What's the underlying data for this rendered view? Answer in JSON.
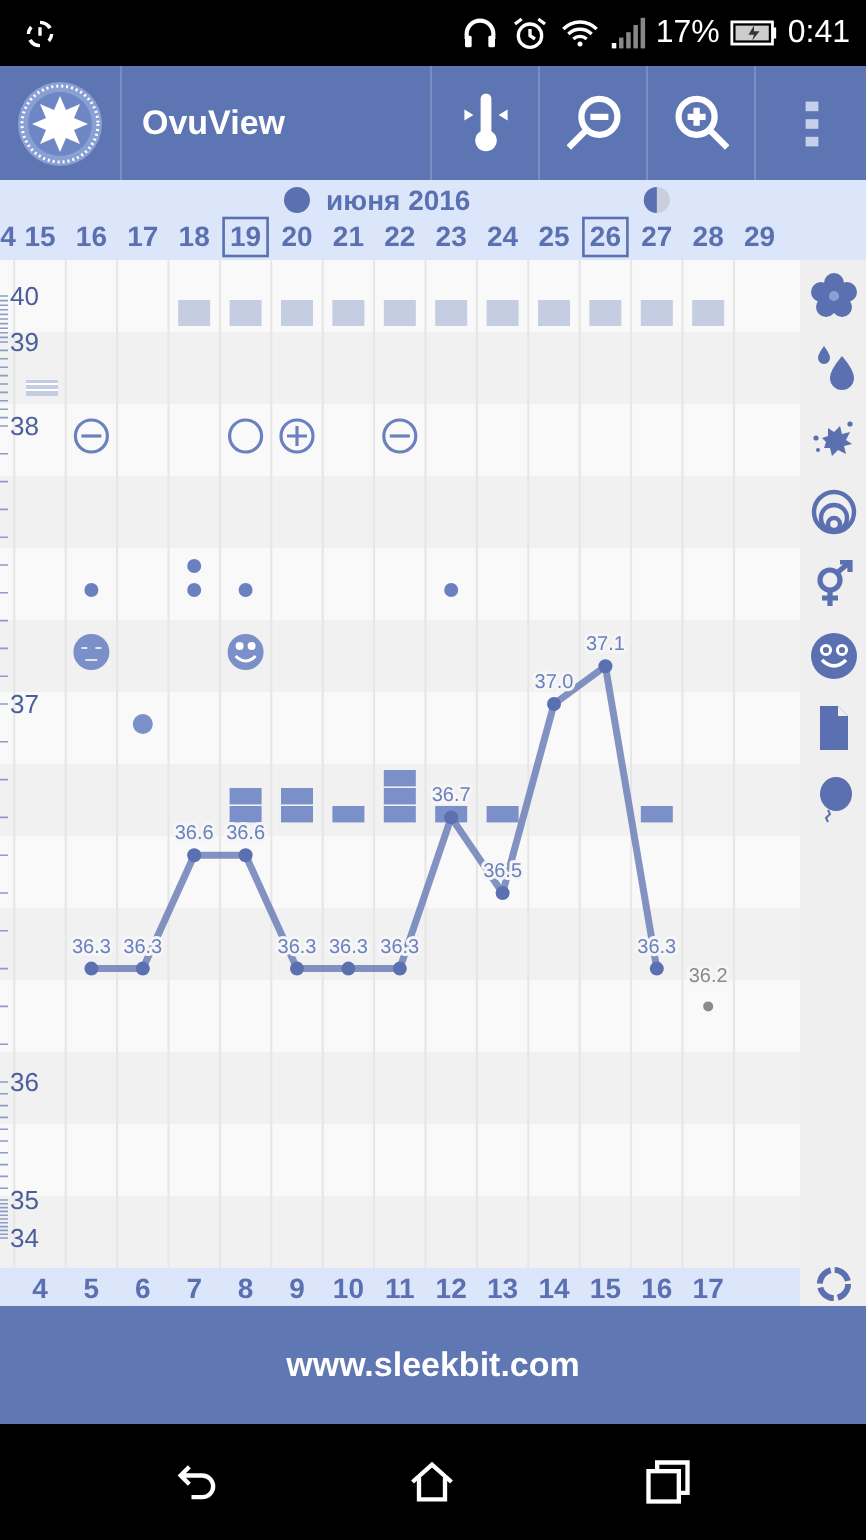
{
  "status_bar": {
    "battery": "17%",
    "time": "0:41"
  },
  "app_bar": {
    "title": "OvuView"
  },
  "month_header": {
    "label": "июня 2016"
  },
  "columns": [
    {
      "date": "4",
      "boxed": false
    },
    {
      "date": "15",
      "boxed": false,
      "marks": [
        {
          "kind": "checkered"
        }
      ]
    },
    {
      "date": "16",
      "boxed": false,
      "marks": [
        {
          "kind": "minus-circle"
        },
        {
          "kind": "dot"
        },
        {
          "kind": "neutral-face"
        }
      ]
    },
    {
      "date": "17",
      "boxed": false,
      "marks": [
        {
          "kind": "big-dot"
        }
      ]
    },
    {
      "date": "18",
      "boxed": false,
      "marks": [
        {
          "kind": "square"
        },
        {
          "kind": "double-dot"
        }
      ]
    },
    {
      "date": "19",
      "boxed": true,
      "marks": [
        {
          "kind": "square"
        },
        {
          "kind": "circle"
        },
        {
          "kind": "dot"
        },
        {
          "kind": "happy-face"
        },
        {
          "kind": "bar"
        },
        {
          "kind": "bar"
        }
      ]
    },
    {
      "date": "20",
      "boxed": false,
      "marks": [
        {
          "kind": "full-moon"
        },
        {
          "kind": "square"
        },
        {
          "kind": "plus-circle"
        },
        {
          "kind": "bar"
        },
        {
          "kind": "bar"
        }
      ]
    },
    {
      "date": "21",
      "boxed": false,
      "marks": [
        {
          "kind": "square"
        },
        {
          "kind": "bar"
        }
      ]
    },
    {
      "date": "22",
      "boxed": false,
      "marks": [
        {
          "kind": "square"
        },
        {
          "kind": "minus-circle"
        },
        {
          "kind": "bar"
        },
        {
          "kind": "bar"
        },
        {
          "kind": "bar"
        }
      ]
    },
    {
      "date": "23",
      "boxed": false,
      "marks": [
        {
          "kind": "square"
        },
        {
          "kind": "dot"
        },
        {
          "kind": "bar"
        }
      ]
    },
    {
      "date": "24",
      "boxed": false,
      "marks": [
        {
          "kind": "square"
        },
        {
          "kind": "bar"
        }
      ]
    },
    {
      "date": "25",
      "boxed": false,
      "marks": [
        {
          "kind": "square"
        }
      ]
    },
    {
      "date": "26",
      "boxed": true,
      "marks": [
        {
          "kind": "square"
        }
      ]
    },
    {
      "date": "27",
      "boxed": false,
      "marks": [
        {
          "kind": "half-moon"
        },
        {
          "kind": "square"
        },
        {
          "kind": "bar"
        }
      ]
    },
    {
      "date": "28",
      "boxed": false,
      "marks": [
        {
          "kind": "square"
        }
      ]
    },
    {
      "date": "29",
      "boxed": false
    }
  ],
  "chart_data": {
    "type": "line",
    "categories": [
      "4",
      "5",
      "6",
      "7",
      "8",
      "9",
      "10",
      "11",
      "12",
      "13",
      "14",
      "15",
      "16",
      "17"
    ],
    "series": [
      {
        "color": "#5a70b0",
        "marker": "circle",
        "values": [
          null,
          36.3,
          36.3,
          36.6,
          36.6,
          36.3,
          36.3,
          36.3,
          36.7,
          36.5,
          37.0,
          37.1,
          36.3,
          null
        ],
        "value_labels": [
          null,
          "36.3",
          "36.3",
          "36.6",
          "36.6",
          "36.3",
          "36.3",
          "36.3",
          "36.7",
          "36.5",
          "37.0",
          "37.1",
          "36.3",
          null
        ]
      },
      {
        "color": "#8a8a8a",
        "marker": "circle",
        "values": [
          null,
          null,
          null,
          null,
          null,
          null,
          null,
          null,
          null,
          null,
          null,
          null,
          null,
          36.2
        ],
        "value_labels": [
          null,
          null,
          null,
          null,
          null,
          null,
          null,
          null,
          null,
          null,
          null,
          null,
          null,
          "36.2"
        ]
      }
    ]
  },
  "y_axis_labels": [
    "40",
    "39",
    "38",
    "37",
    "36",
    "35",
    "34"
  ],
  "footer": {
    "link": "www.sleekbit.com"
  }
}
